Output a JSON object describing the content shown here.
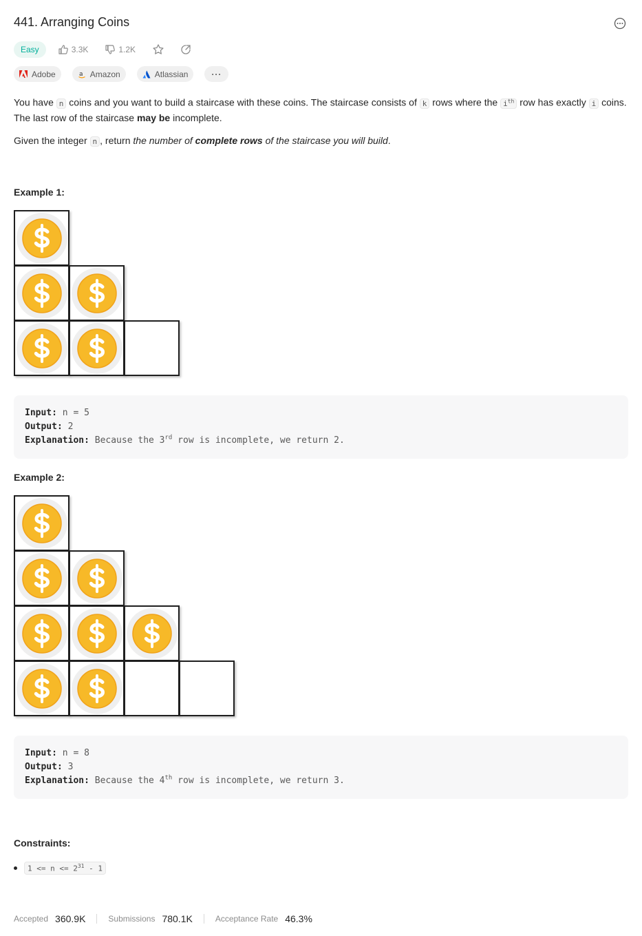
{
  "problem": {
    "title": "441. Arranging Coins",
    "difficulty": "Easy",
    "likes": "3.3K",
    "dislikes": "1.2K"
  },
  "companies": [
    {
      "name": "Adobe",
      "color": "#e1251b"
    },
    {
      "name": "Amazon",
      "color": "#ff9900"
    },
    {
      "name": "Atlassian",
      "color": "#2684ff"
    }
  ],
  "more_tags_label": "···",
  "description": {
    "p1_a": "You have ",
    "p1_code_n": "n",
    "p1_b": " coins and you want to build a staircase with these coins. The staircase consists of ",
    "p1_code_k": "k",
    "p1_c": " rows where the ",
    "p1_code_i": "i",
    "p1_sup_th": "th",
    "p1_d": " row has exactly ",
    "p1_code_i2": "i",
    "p1_e": " coins. The last row of the staircase ",
    "p1_bold": "may be",
    "p1_f": " incomplete.",
    "p2_a": "Given the integer ",
    "p2_code_n": "n",
    "p2_b": ", return ",
    "p2_i1": "the number of ",
    "p2_bi": "complete rows",
    "p2_i2": " of the staircase you will build",
    "p2_end": "."
  },
  "examples": [
    {
      "title": "Example 1:",
      "rows": [
        1,
        2,
        2
      ],
      "row_lengths": [
        1,
        2,
        3
      ],
      "input_label": "Input:",
      "input_value": "n = 5",
      "output_label": "Output:",
      "output_value": "2",
      "explanation_label": "Explanation:",
      "explanation_a": "Because the 3",
      "explanation_sup": "rd",
      "explanation_b": " row is incomplete, we return 2."
    },
    {
      "title": "Example 2:",
      "rows": [
        1,
        2,
        3,
        2
      ],
      "row_lengths": [
        1,
        2,
        3,
        4
      ],
      "input_label": "Input:",
      "input_value": "n = 8",
      "output_label": "Output:",
      "output_value": "3",
      "explanation_label": "Explanation:",
      "explanation_a": "Because the 4",
      "explanation_sup": "th",
      "explanation_b": " row is incomplete, we return 3."
    }
  ],
  "constraints": {
    "title": "Constraints:",
    "item_a": "1 <= n <= 2",
    "item_sup": "31",
    "item_b": " - 1"
  },
  "stats": {
    "accepted_label": "Accepted",
    "accepted_value": "360.9K",
    "submissions_label": "Submissions",
    "submissions_value": "780.1K",
    "rate_label": "Acceptance Rate",
    "rate_value": "46.3%"
  },
  "colors": {
    "easy": "#00af9b",
    "coin": "#f7b928",
    "coin_dark": "#f0a21a"
  }
}
